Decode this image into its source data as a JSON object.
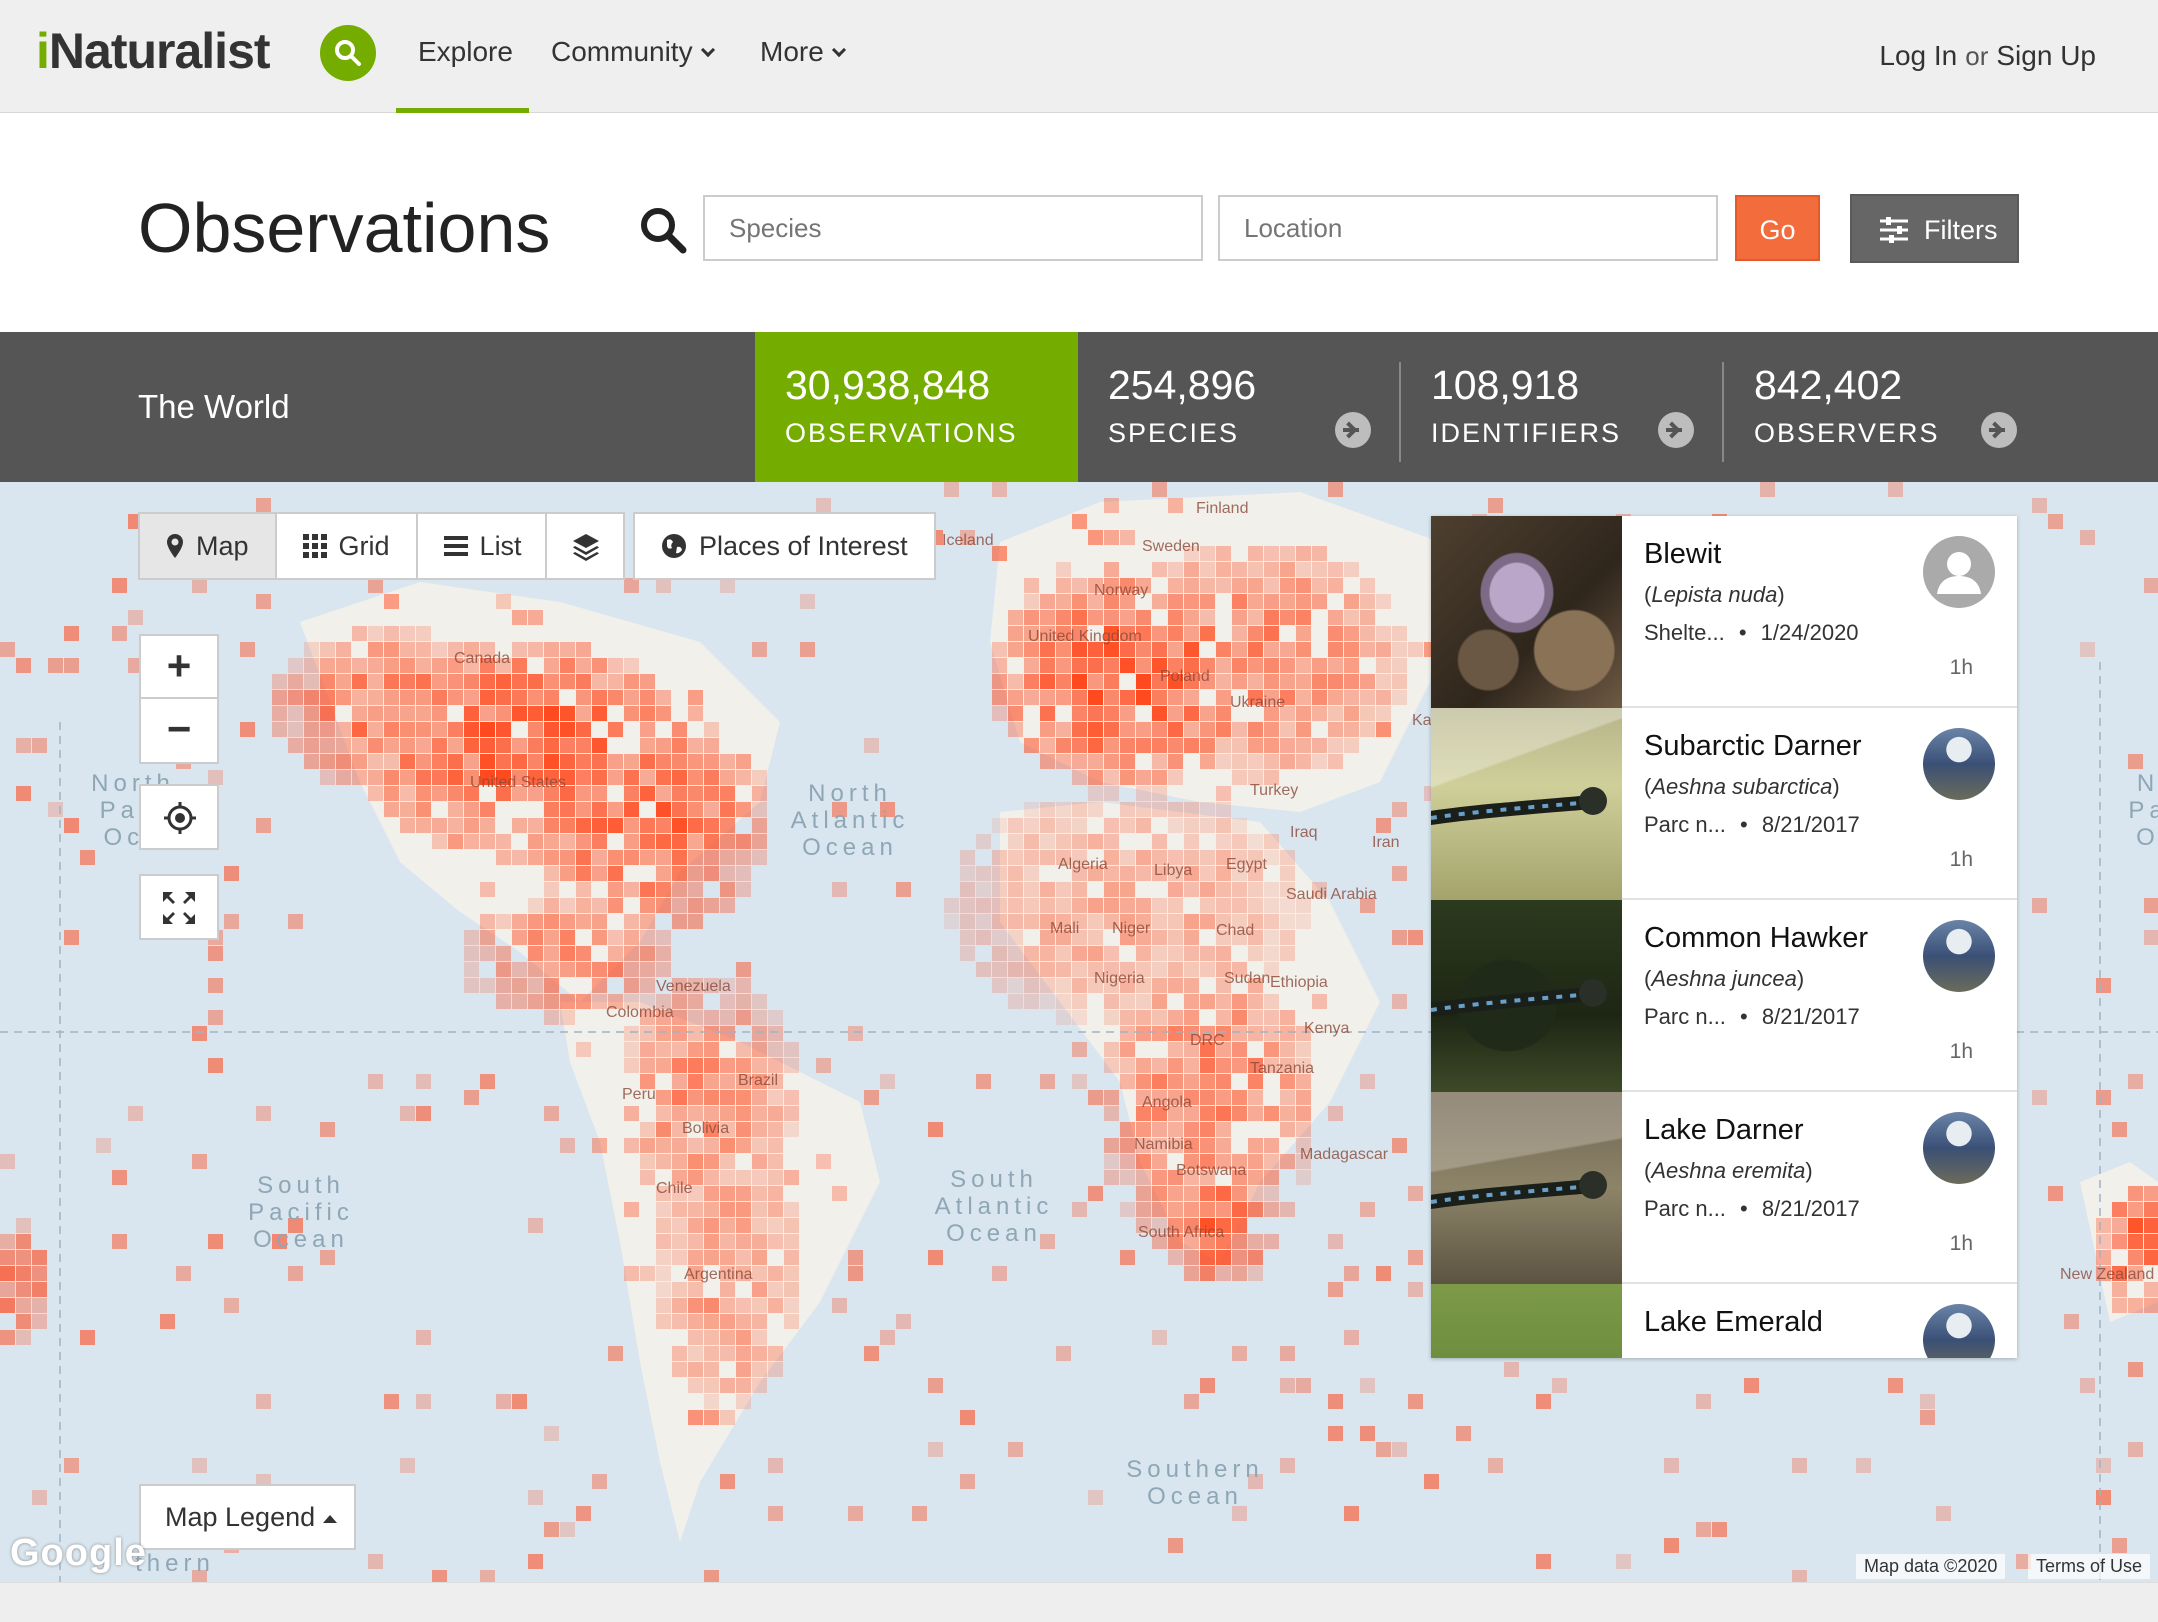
{
  "header": {
    "logo_i": "i",
    "logo_rest": "Naturalist",
    "nav": [
      {
        "label": "Explore"
      },
      {
        "label": "Community"
      },
      {
        "label": "More"
      }
    ],
    "login": "Log In",
    "or": "or",
    "signup": "Sign Up"
  },
  "page": {
    "title": "Observations",
    "species_placeholder": "Species",
    "location_placeholder": "Location",
    "go_label": "Go",
    "filters_label": "Filters"
  },
  "stats": {
    "place": "The World",
    "items": [
      {
        "number": "30,938,848",
        "label": "OBSERVATIONS"
      },
      {
        "number": "254,896",
        "label": "SPECIES"
      },
      {
        "number": "108,918",
        "label": "IDENTIFIERS"
      },
      {
        "number": "842,402",
        "label": "OBSERVERS"
      }
    ]
  },
  "map": {
    "view_buttons": [
      {
        "label": "Map",
        "icon": "map-marker-icon",
        "active": true
      },
      {
        "label": "Grid",
        "icon": "grid-icon",
        "active": false
      },
      {
        "label": "List",
        "icon": "list-icon",
        "active": false
      }
    ],
    "places_of_interest": "Places of Interest",
    "zoom_in": "+",
    "zoom_out": "−",
    "legend_label": "Map Legend",
    "google": "Google",
    "map_data": "Map data ©2020",
    "terms": "Terms of Use",
    "ocean_labels": [
      {
        "text": "North\nPaci\nOce"
      },
      {
        "text": "North\nAtlantic\nOcean"
      },
      {
        "text": "South\nPacific\nOcean"
      },
      {
        "text": "South\nAtlantic\nOcean"
      },
      {
        "text": "Southern\nOcean"
      },
      {
        "text": "thern"
      },
      {
        "text": "N\nPa\nO"
      }
    ],
    "country_labels": [
      "Finland",
      "Sweden",
      "Iceland",
      "Norway",
      "United Kingdom",
      "Poland",
      "Ukraine",
      "Canada",
      "United States",
      "Turkey",
      "Iraq",
      "Iran",
      "Algeria",
      "Libya",
      "Egypt",
      "Saudi Arabia",
      "Mali",
      "Niger",
      "Chad",
      "Sudan",
      "Nigeria",
      "Ethiopia",
      "Venezuela",
      "Colombia",
      "DRC",
      "Kenya",
      "Tanzania",
      "Brazil",
      "Peru",
      "Bolivia",
      "Angola",
      "Namibia",
      "Botswana",
      "Madagascar",
      "Chile",
      "Argentina",
      "South Africa",
      "New Zealand",
      "Ka"
    ],
    "heat_color": "#ff4a1f",
    "water_color": "#d9e6ef",
    "land_color": "#f2f0ea"
  },
  "observations": [
    {
      "name": "Blewit",
      "scientific": "Lepista nuda",
      "place": "Shelte...",
      "date": "1/24/2020",
      "time": "1h",
      "avatar": "default-user-icon"
    },
    {
      "name": "Subarctic Darner",
      "scientific": "Aeshna subarctica",
      "place": "Parc n...",
      "date": "8/21/2017",
      "time": "1h",
      "avatar": "user-photo"
    },
    {
      "name": "Common Hawker",
      "scientific": "Aeshna juncea",
      "place": "Parc n...",
      "date": "8/21/2017",
      "time": "1h",
      "avatar": "user-photo"
    },
    {
      "name": "Lake Darner",
      "scientific": "Aeshna eremita",
      "place": "Parc n...",
      "date": "8/21/2017",
      "time": "1h",
      "avatar": "user-photo"
    },
    {
      "name": "Lake Emerald",
      "scientific": "",
      "place": "",
      "date": "",
      "time": "",
      "avatar": "user-photo"
    }
  ],
  "sep": "•",
  "paren_open": "(",
  "paren_close": ")"
}
